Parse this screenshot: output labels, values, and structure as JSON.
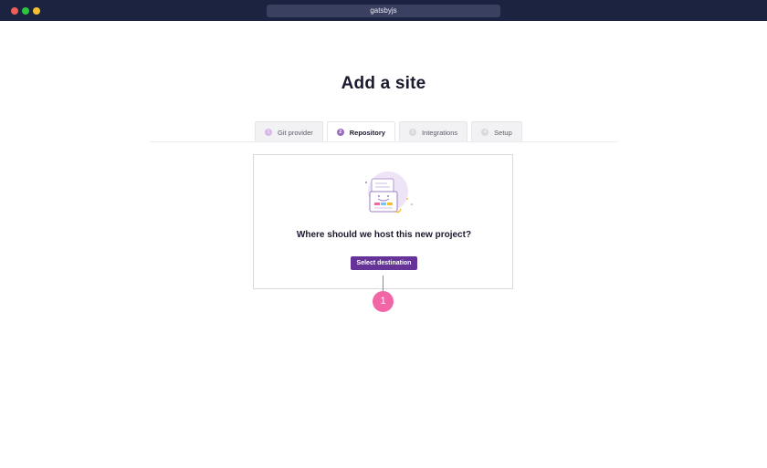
{
  "window": {
    "url": "gatsbyjs"
  },
  "page": {
    "title": "Add a site"
  },
  "tabs": [
    {
      "number": "1",
      "label": "Git provider"
    },
    {
      "number": "2",
      "label": "Repository"
    },
    {
      "number": "3",
      "label": "Integrations"
    },
    {
      "number": "4",
      "label": "Setup"
    }
  ],
  "active_tab": "Repository",
  "card": {
    "illustration_icon": "site-illustration",
    "question": "Where should we host this new project?",
    "button_label": "Select destination"
  },
  "annotation": {
    "badge": "1"
  },
  "colors": {
    "accent": "#663399",
    "annotation": "#f266a6",
    "titlebar": "#1c2340"
  }
}
